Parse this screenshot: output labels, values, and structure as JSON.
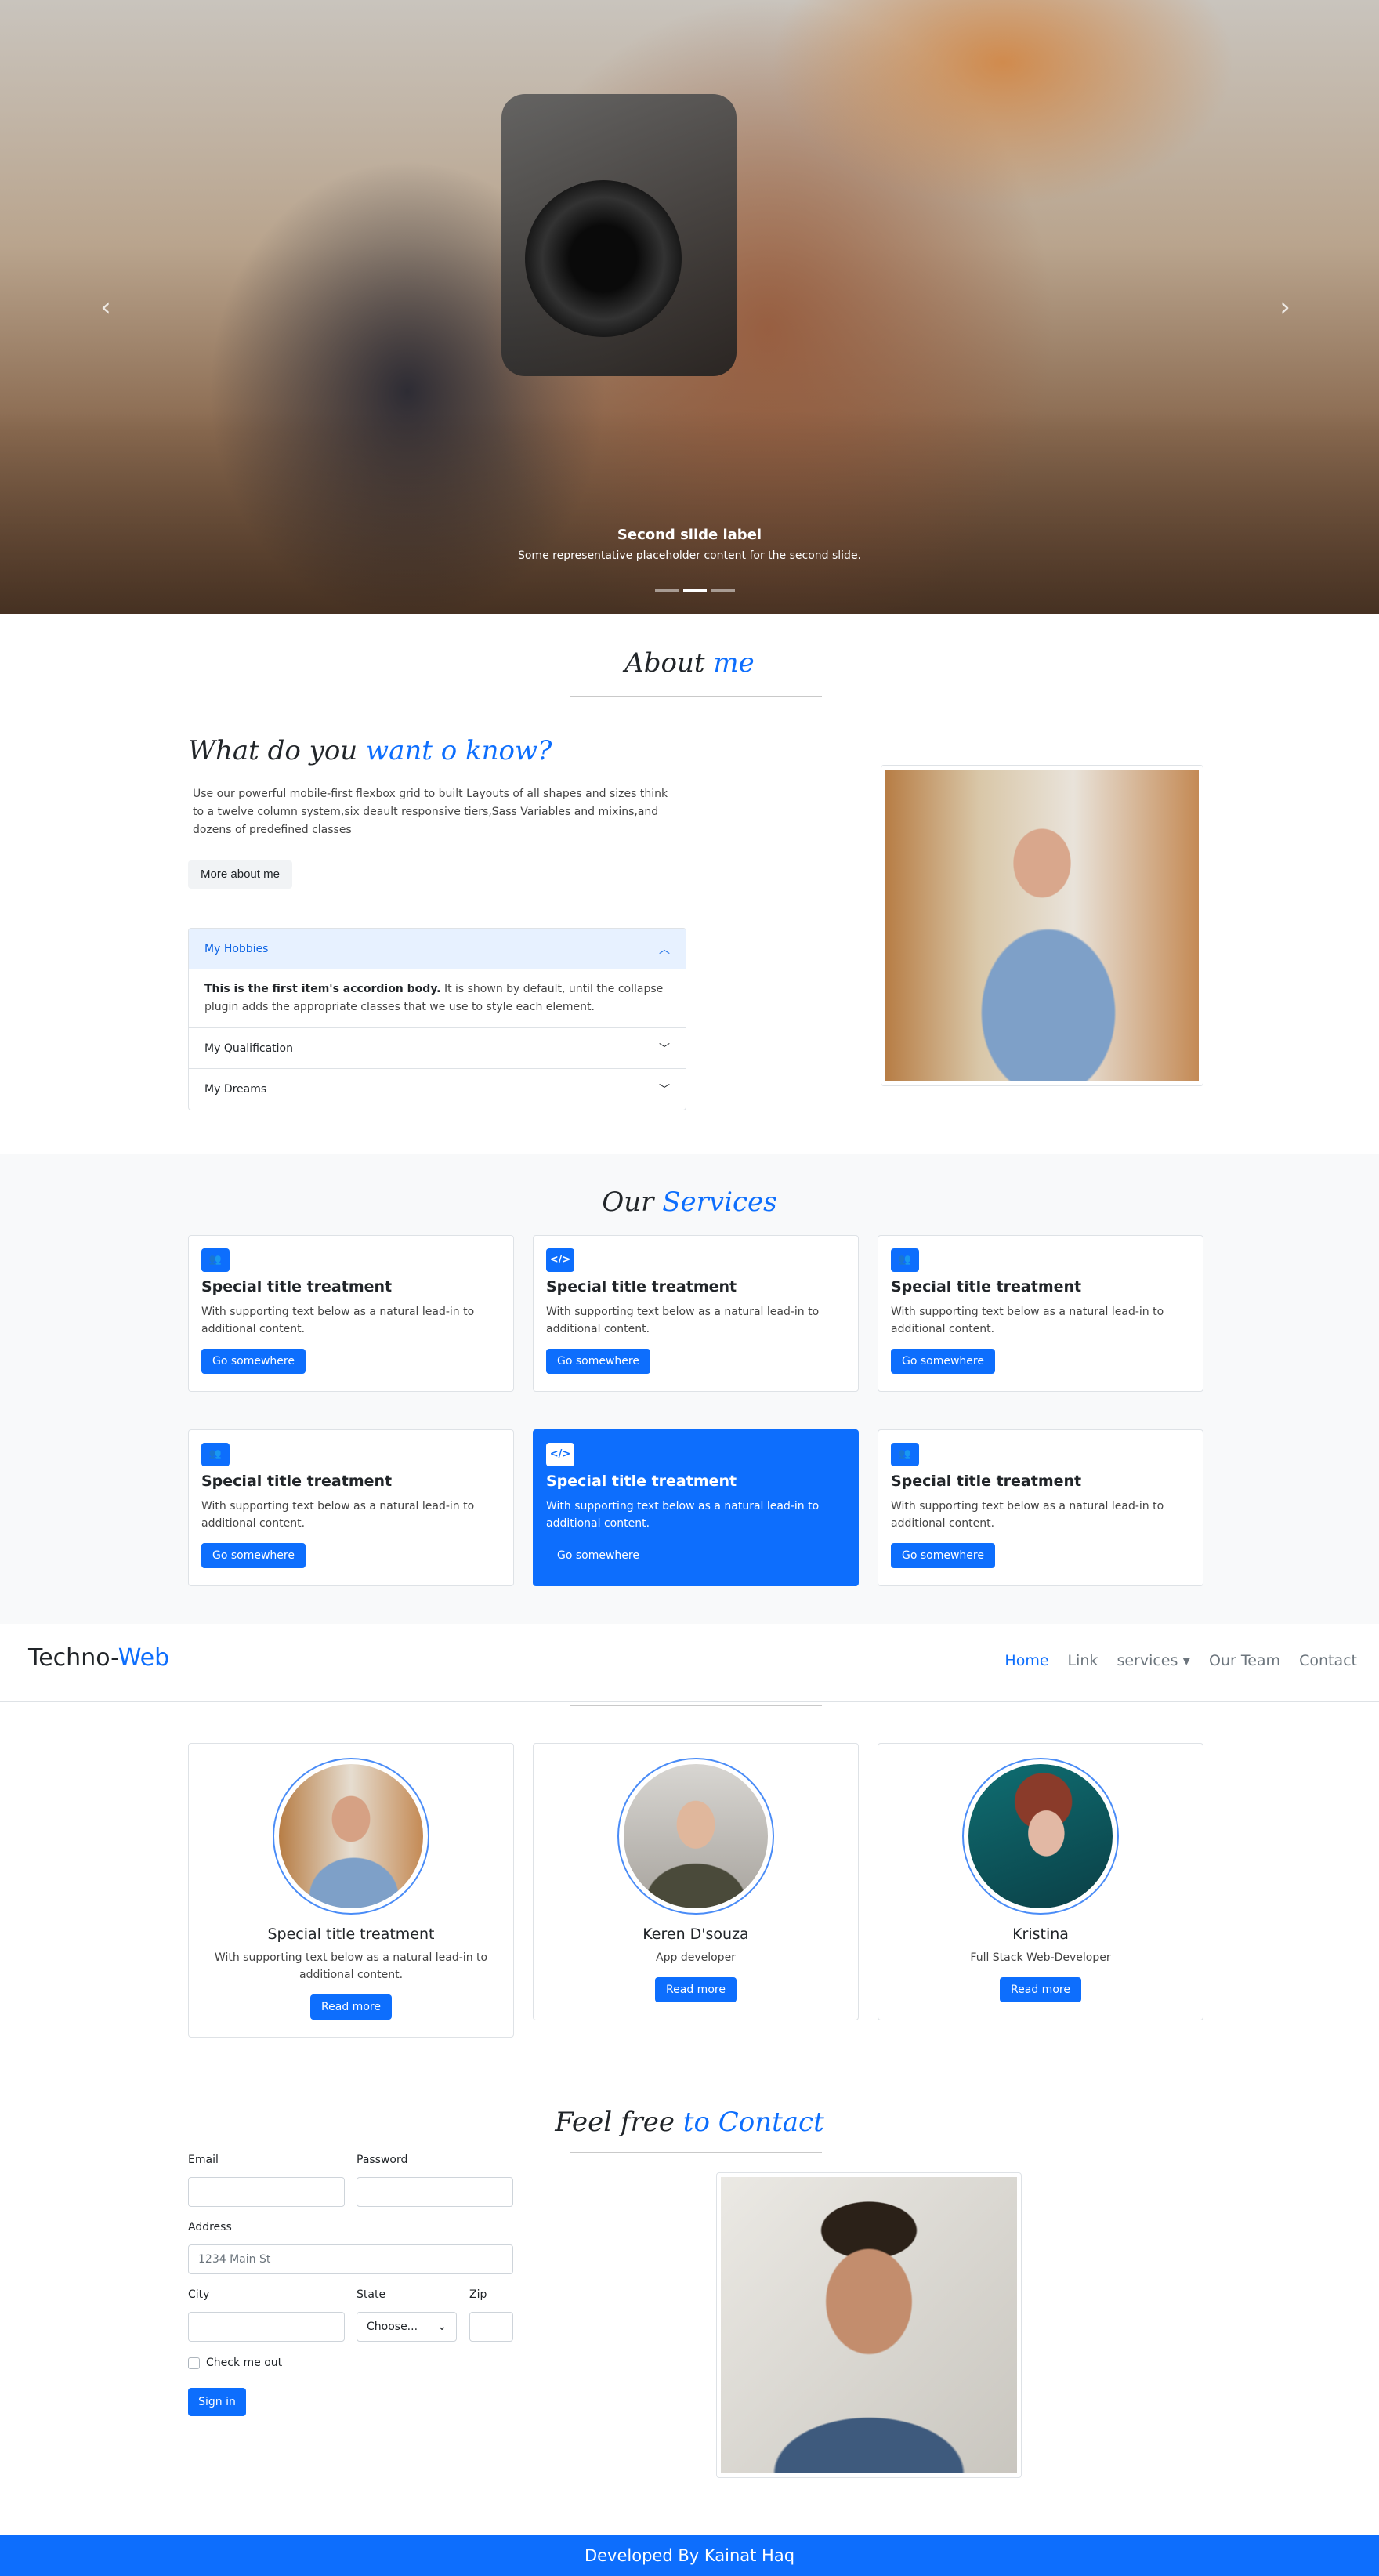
{
  "hero": {
    "caption_title": "Second slide label",
    "caption_text": "Some representative placeholder content for the second slide.",
    "prev_icon": "chevron-left-icon",
    "next_icon": "chevron-right-icon",
    "slides_count": 3,
    "active_slide": 2
  },
  "about": {
    "title_plain": "About",
    "title_accent": "me",
    "heading_plain": "What do you",
    "heading_accent": "want o know?",
    "paragraph": "Use our powerful mobile-first flexbox grid to built Layouts of all shapes and sizes think to a twelve column system,six deault responsive tiers,Sass Variables and mixins,and dozens of predefined classes",
    "button": "More about me",
    "accordion": [
      {
        "label": "My Hobbies",
        "open": true,
        "body_bold": "This is the first item's accordion body.",
        "body_rest": "It is shown by default, until the collapse plugin adds the appropriate classes that we use to style each element."
      },
      {
        "label": "My Qualification",
        "open": false
      },
      {
        "label": "My Dreams",
        "open": false
      }
    ]
  },
  "services": {
    "title_plain": "Our",
    "title_accent": "Services",
    "cards": [
      {
        "icon": "users-icon",
        "title": "Special title treatment",
        "text": "With supporting text below as a natural lead-in to additional content.",
        "button": "Go somewhere"
      },
      {
        "icon": "code-icon",
        "title": "Special title treatment",
        "text": "With supporting text below as a natural lead-in to additional content.",
        "button": "Go somewhere"
      },
      {
        "icon": "users-icon",
        "title": "Special title treatment",
        "text": "With supporting text below as a natural lead-in to additional content.",
        "button": "Go somewhere"
      },
      {
        "icon": "users-icon",
        "title": "Special title treatment",
        "text": "With supporting text below as a natural lead-in to additional content.",
        "button": "Go somewhere"
      },
      {
        "icon": "code-icon",
        "title": "Special title treatment",
        "text": "With supporting text below as a natural lead-in to additional content.",
        "button": "Go somewhere"
      },
      {
        "icon": "users-icon",
        "title": "Special title treatment",
        "text": "With supporting text below as a natural lead-in to additional content.",
        "button": "Go somewhere"
      }
    ]
  },
  "navbar": {
    "brand_plain": "Techno-",
    "brand_accent": "Web",
    "links": [
      "Home",
      "Link",
      "services",
      "Our Team",
      "Contact"
    ],
    "active_link": "Home"
  },
  "team": [
    {
      "name": "Special title treatment",
      "role": "With supporting text below as a natural lead-in to additional content.",
      "button": "Read more"
    },
    {
      "name": "Keren D'souza",
      "role": "App developer",
      "button": "Read more"
    },
    {
      "name": "Kristina",
      "role": "Full Stack Web-Developer",
      "button": "Read more"
    }
  ],
  "contact": {
    "title_plain": "Feel free",
    "title_accent": "to Contact",
    "email_label": "Email",
    "password_label": "Password",
    "address_label": "Address",
    "address_placeholder": "1234 Main St",
    "city_label": "City",
    "state_label": "State",
    "state_value": "Choose...",
    "zip_label": "Zip",
    "check_label": "Check me out",
    "submit": "Sign in"
  },
  "footer": {
    "text": "Developed By Kainat Haq"
  },
  "colors": {
    "primary": "#0d6efd",
    "light_bg": "#f8f9fa",
    "accordion_open_bg": "#e7f1ff"
  }
}
